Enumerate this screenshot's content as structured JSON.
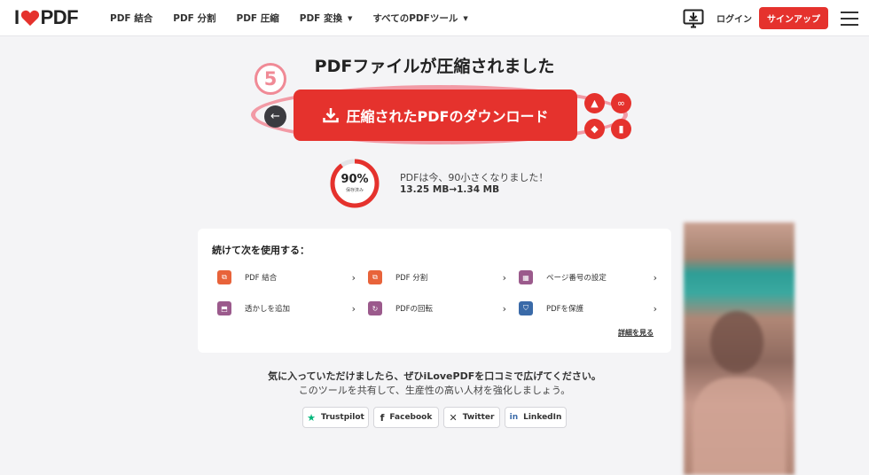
{
  "brand": {
    "logo_left": "I",
    "logo_right": "PDF",
    "accent": "#e5322d"
  },
  "nav": [
    {
      "label": "PDF 結合",
      "dropdown": false
    },
    {
      "label": "PDF 分割",
      "dropdown": false
    },
    {
      "label": "PDF 圧縮",
      "dropdown": false
    },
    {
      "label": "PDF 変換",
      "dropdown": true
    },
    {
      "label": "すべてのPDFツール",
      "dropdown": true
    }
  ],
  "header": {
    "login": "ログイン",
    "signup": "サインアップ",
    "icons": [
      "desktop-download-icon",
      "menu-icon"
    ]
  },
  "main": {
    "title": "PDFファイルが圧縮されました",
    "step_badge": "5",
    "download_label": "圧縮されたPDFのダウンロード",
    "side_icons": [
      "google-drive-icon",
      "link-icon",
      "dropbox-icon",
      "trash-icon"
    ]
  },
  "savings": {
    "percent": "90%",
    "percent_value": 90,
    "percent_sub": "保存済み",
    "message": "PDFは今、90小さくなりました！",
    "sizes": "13.25 MB→1.34 MB"
  },
  "continue": {
    "title": "続けて次を使用する：",
    "tools": [
      {
        "label": "PDF 結合",
        "icon": "merge-icon",
        "color": "#e8633a"
      },
      {
        "label": "PDF 分割",
        "icon": "split-icon",
        "color": "#e8633a"
      },
      {
        "label": "ページ番号の設定",
        "icon": "page-numbers-icon",
        "color": "#9b5a8c"
      },
      {
        "label": "透かしを追加",
        "icon": "watermark-icon",
        "color": "#9b5a8c"
      },
      {
        "label": "PDFの回転",
        "icon": "rotate-icon",
        "color": "#9b5a8c"
      },
      {
        "label": "PDFを保護",
        "icon": "protect-icon",
        "color": "#3a6aa8"
      }
    ],
    "more": "詳細を見る"
  },
  "share": {
    "line1": "気に入っていただけましたら、ぜひiLovePDFを口コミで広げてください。",
    "line2": "このツールを共有して、生産性の高い人材を強化しましょう。",
    "buttons": [
      {
        "label": "Trustpilot",
        "icon": "trustpilot-star-icon",
        "color": "#00b67a"
      },
      {
        "label": "Facebook",
        "icon": "facebook-icon",
        "color": "#333333"
      },
      {
        "label": "Twitter",
        "icon": "x-twitter-icon",
        "color": "#333333"
      },
      {
        "label": "LinkedIn",
        "icon": "linkedin-icon",
        "color": "#3a6aa8"
      }
    ]
  }
}
